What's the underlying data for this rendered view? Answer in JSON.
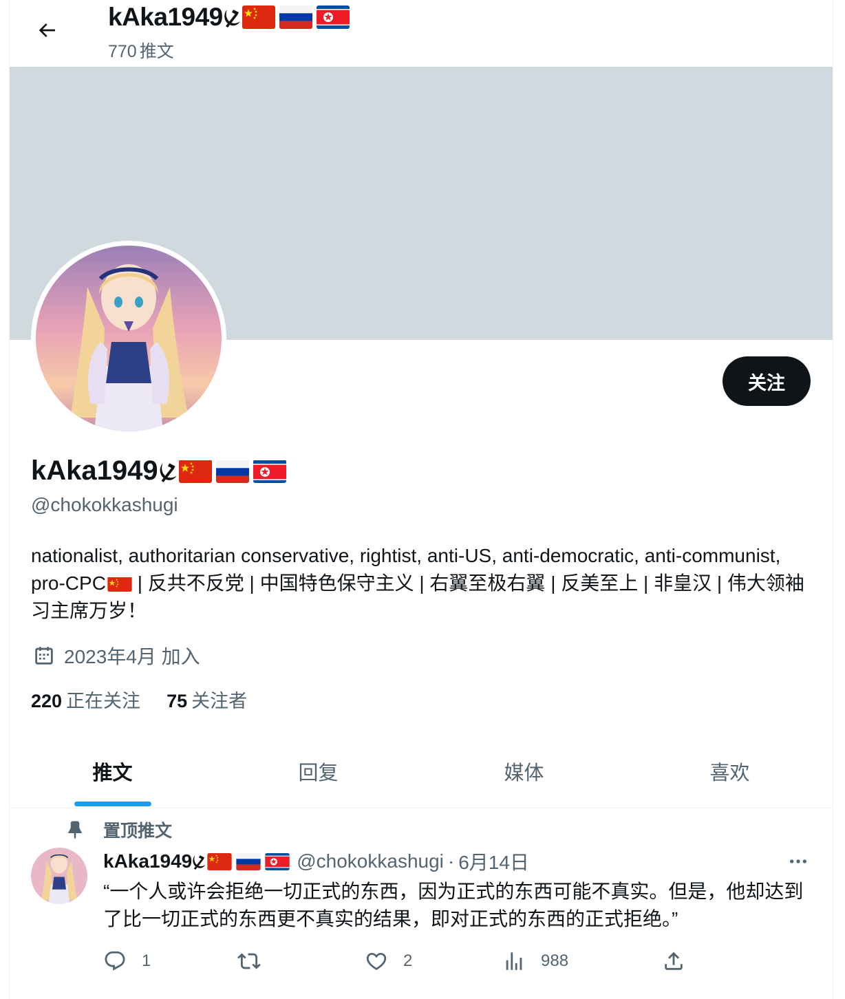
{
  "header": {
    "back_label": "Back",
    "display_name": "kAka1949",
    "tweet_count": "770",
    "tweet_count_label": "推文"
  },
  "profile": {
    "display_name": "kAka1949",
    "handle": "@chokokkashugi",
    "follow_label": "关注",
    "bio_part1": "nationalist, authoritarian conservative, rightist, anti-US, anti-democratic, anti-communist, pro-CPC",
    "bio_part2": " | 反共不反党 | 中国特色保守主义 | 右翼至极右翼 | 反美至上 | 非皇汉 | 伟大领袖习主席万岁！",
    "joined": "2023年4月 加入",
    "following_count": "220",
    "following_label": "正在关注",
    "followers_count": "75",
    "followers_label": "关注者",
    "name_emojis": [
      "hammer-sickle-icon",
      "china-flag-icon",
      "russia-flag-icon",
      "north-korea-flag-icon"
    ]
  },
  "tabs": [
    {
      "label": "推文",
      "active": true
    },
    {
      "label": "回复",
      "active": false
    },
    {
      "label": "媒体",
      "active": false
    },
    {
      "label": "喜欢",
      "active": false
    }
  ],
  "pinned_tweet": {
    "pinned_label": "置顶推文",
    "author_name": "kAka1949",
    "author_handle": "@chokokkashugi",
    "separator": "·",
    "date": "6月14日",
    "text": "“一个人或许会拒绝一切正式的东西，因为正式的东西可能不真实。但是，他却达到了比一切正式的东西更不真实的结果，即对正式的东西的正式拒绝。”",
    "reply_count": "1",
    "retweet_count": "",
    "like_count": "2",
    "view_count": "988"
  },
  "colors": {
    "banner": "#cfd9de",
    "accent": "#1d9bf0",
    "text_primary": "#0f1419",
    "text_secondary": "#536471",
    "follow_button_bg": "#0f1419"
  }
}
